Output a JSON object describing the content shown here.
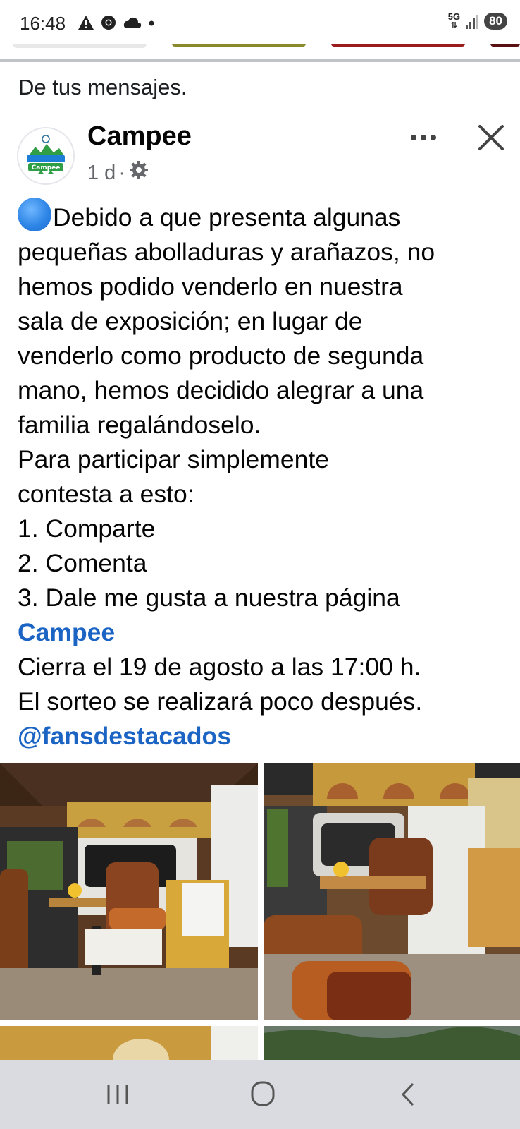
{
  "status_bar": {
    "time": "16:48",
    "icons": [
      "warning-icon",
      "chrome-icon",
      "cloud-icon",
      "dot-icon"
    ],
    "network": "5G",
    "battery": "80"
  },
  "feed": {
    "section_label": "De tus mensajes."
  },
  "post": {
    "author": "Campee",
    "time": "1 d",
    "separator": "·",
    "privacy_icon": "gear-icon",
    "avatar_text": "Campee",
    "lines": [
      "Debido a que presenta algunas",
      "pequeñas abolladuras y arañazos, no",
      "hemos podido venderlo en nuestra",
      "sala de exposición; en lugar de",
      "venderlo como producto de segunda",
      "mano, hemos decidido alegrar a una",
      "familia regalándoselo.",
      "Para participar simplemente",
      "contesta a esto:",
      "1. Comparte",
      "2. Comenta",
      "3. Dale me gusta a nuestra página"
    ],
    "page_link": "Campee",
    "closing_lines": [
      "Cierra el 19 de agosto a las 17:00 h.",
      "El sorteo se realizará poco después."
    ],
    "mention": "@fansdestacados"
  },
  "colors": {
    "link": "#1b64c3",
    "text": "#050505",
    "muted": "#65676b"
  }
}
